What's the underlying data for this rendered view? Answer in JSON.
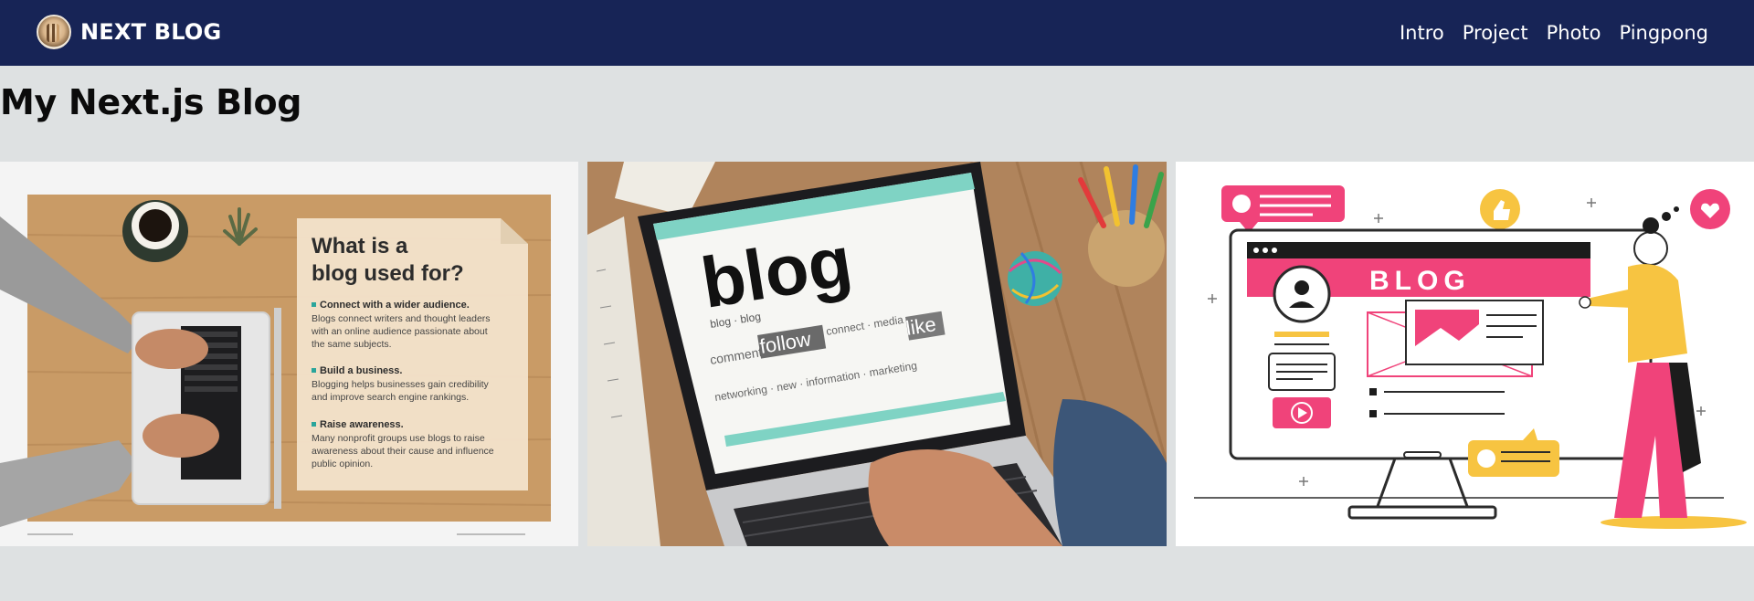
{
  "navbar": {
    "brand": "NEXT BLOG",
    "links": [
      "Intro",
      "Project",
      "Photo",
      "Pingpong"
    ]
  },
  "main": {
    "title": "My Next.js Blog"
  },
  "gallery": {
    "card1": {
      "heading_line1": "What is a",
      "heading_line2": "blog used for?",
      "items": [
        {
          "title": "Connect with a wider audience.",
          "lines": [
            "Blogs connect writers and thought leaders",
            "with an online audience passionate about",
            "the same subjects."
          ]
        },
        {
          "title": "Build a business.",
          "lines": [
            "Blogging helps businesses gain credibility",
            "and improve search engine rankings."
          ]
        },
        {
          "title": "Raise awareness.",
          "lines": [
            "Many nonprofit groups use blogs to raise",
            "awareness about their cause and influence",
            "public opinion."
          ]
        }
      ]
    },
    "card2": {
      "word_blog": "blog",
      "word_follow": "follow",
      "word_like": "like",
      "tagline_1": "blog · blog",
      "tagline_2": "comment",
      "tagline_3": "connect · media",
      "tagline_4": "networking · new · information · marketing"
    },
    "card3": {
      "screen_text": "BLOG"
    }
  },
  "colors": {
    "navbar": "#172456",
    "page_bg": "#dee1e2",
    "blog_pink": "#f0437a",
    "blog_yellow": "#f7c441"
  }
}
